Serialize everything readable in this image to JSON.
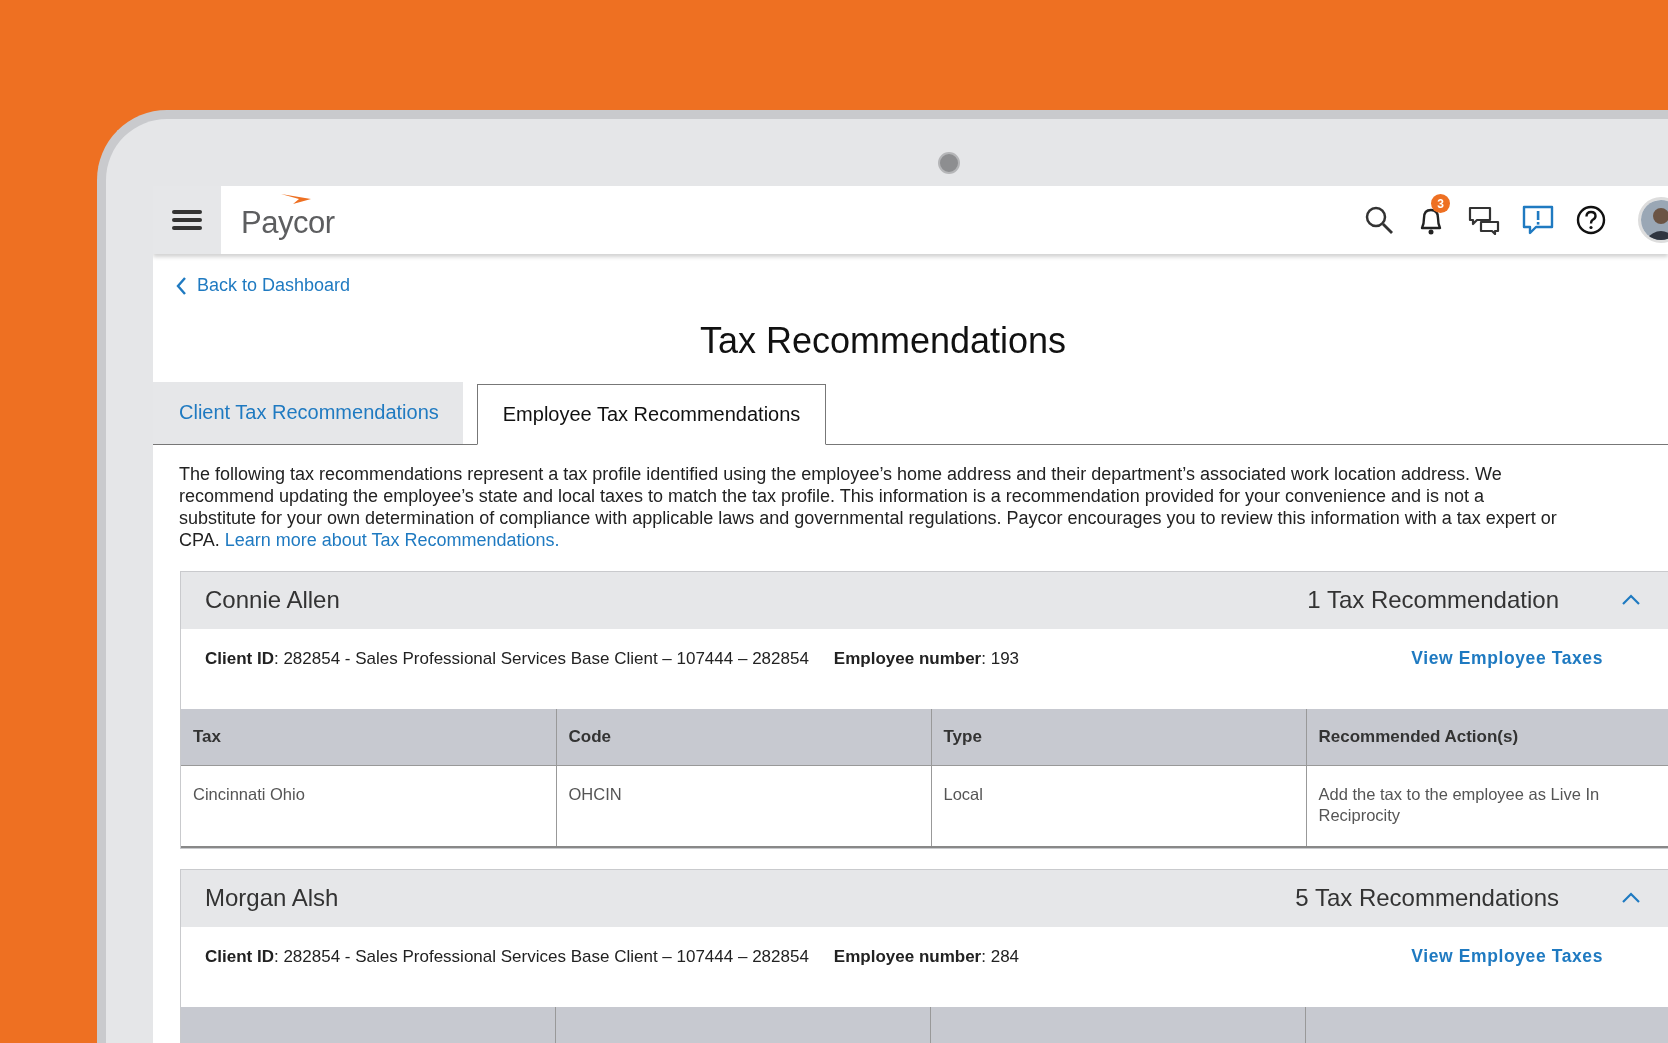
{
  "app": {
    "brand": "Paycor",
    "notification_count": "3"
  },
  "back_link": "Back to Dashboard",
  "title": "Tax Recommendations",
  "tabs": [
    {
      "label": "Client Tax Recommendations",
      "selected": false
    },
    {
      "label": "Employee Tax Recommendations",
      "selected": true
    }
  ],
  "description": {
    "text": "The following tax recommendations represent a tax profile identified using the employee’s home address and their department’s associated work location address. We recommend updating the employee’s state and local taxes to match the tax profile. This information is a recommendation provided for your convenience and is not a substitute for your own determination of compliance with applicable laws and governmental regulations. Paycor encourages you to review this information with a tax expert or CPA.",
    "link": "Learn more about Tax Recommendations."
  },
  "employees": [
    {
      "name": "Connie Allen",
      "count": "1 Tax Recommendation",
      "expanded": true,
      "client_id": "**Client ID**: 282854 - Sales Professional Services Base Client – 107444 – 282854",
      "employee_number": "**Employee number**: 193",
      "action": "View Employee Taxes",
      "table": {
        "columns": [
          "Tax",
          "Code",
          "Type",
          "Recommended Action(s)"
        ],
        "rows": [
          [
            "Cincinnati Ohio",
            "OHCIN",
            "Local",
            "Add the tax to the employee as Live In Reciprocity"
          ]
        ]
      }
    },
    {
      "name": "Morgan Alsh",
      "count": "5 Tax Recommendations",
      "expanded": true,
      "client_id": "**Client ID**: 282854 - Sales Professional Services Base Client – 107444 – 282854",
      "employee_number": "**Employee number**: 284",
      "action": "View Employee Taxes"
    }
  ]
}
